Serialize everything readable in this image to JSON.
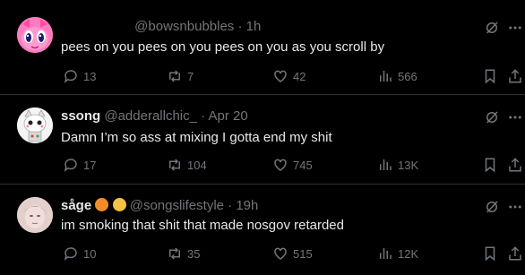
{
  "tweets": [
    {
      "display_name": "",
      "handle": "@bowsnbubbles",
      "time": "1h",
      "text": "pees on you pees on you pees on you as you scroll by",
      "replies": "13",
      "reposts": "7",
      "likes": "42",
      "views": "566"
    },
    {
      "display_name": "ssong",
      "handle": "@adderallchic_",
      "time": "Apr 20",
      "text": "Damn I’m so ass at mixing I gotta end my shit",
      "replies": "17",
      "reposts": "104",
      "likes": "745",
      "views": "13K"
    },
    {
      "display_name": "såge",
      "handle": "@songslifestyle",
      "time": "19h",
      "text": "im smoking that shit that made nosgov retarded",
      "replies": "10",
      "reposts": "35",
      "likes": "515",
      "views": "12K"
    }
  ],
  "separator": "·",
  "colors": {
    "background": "#000000",
    "text": "#e7e9ea",
    "muted": "#71767b",
    "divider": "#2f3336"
  }
}
